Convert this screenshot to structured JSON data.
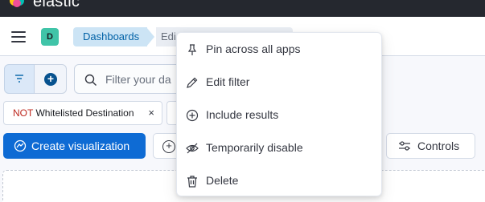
{
  "brand": {
    "name": "elastic"
  },
  "header": {
    "space_initial": "D",
    "breadcrumbs": [
      "Dashboards",
      "Edi"
    ]
  },
  "search": {
    "placeholder": "Filter your da"
  },
  "filter_pill": {
    "negation": "NOT",
    "label": "Whitelisted Destination",
    "remove_symbol": "×"
  },
  "toolbar": {
    "create_label": "Create visualization",
    "controls_label": "Controls"
  },
  "context_menu": {
    "items": [
      {
        "label": "Pin across all apps",
        "icon": "pin-icon"
      },
      {
        "label": "Edit filter",
        "icon": "pencil-icon"
      },
      {
        "label": "Include results",
        "icon": "plus-circle-icon"
      },
      {
        "label": "Temporarily disable",
        "icon": "eye-closed-icon"
      },
      {
        "label": "Delete",
        "icon": "trash-icon"
      }
    ]
  },
  "colors": {
    "primary": "#0e6bd4",
    "header_dark": "#25282f",
    "breadcrumb_active_bg": "#cce4f5",
    "breadcrumb_active_text": "#0061a6",
    "negation_red": "#bd271e",
    "space_avatar": "#40c4a8"
  }
}
